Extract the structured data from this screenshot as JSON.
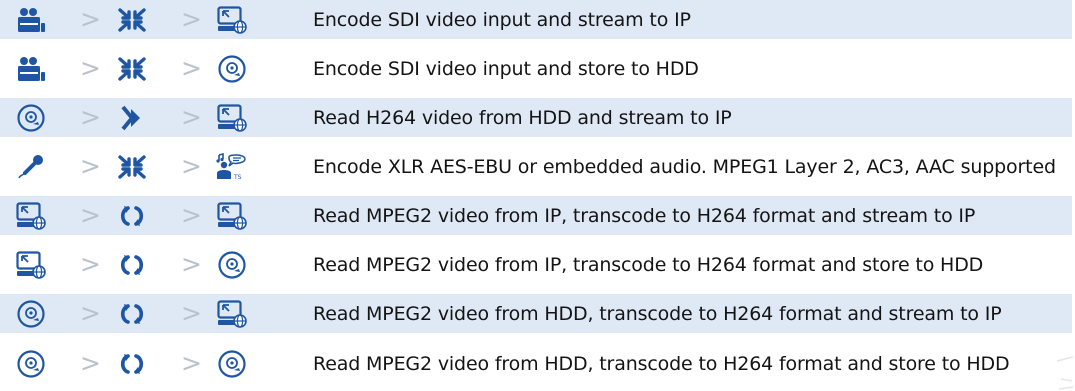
{
  "colors": {
    "icon_blue": "#1f56a4",
    "row_stripe": "#dfe9f5",
    "separator": "#b9c2cc"
  },
  "separator": ">",
  "rows": [
    {
      "icons": [
        "sdi-camera-icon",
        "encode-icon",
        "ip-stream-icon"
      ],
      "text": "Encode SDI video input and stream to IP"
    },
    {
      "icons": [
        "sdi-camera-icon",
        "encode-icon",
        "hdd-icon"
      ],
      "text": "Encode SDI video input and store to HDD"
    },
    {
      "icons": [
        "hdd-icon",
        "play-forward-icon",
        "ip-stream-icon"
      ],
      "text": "Read H264 video from HDD and stream to IP"
    },
    {
      "icons": [
        "microphone-icon",
        "encode-icon",
        "audio-ts-icon"
      ],
      "text": "Encode XLR AES-EBU or embedded audio. MPEG1 Layer 2, AC3, AAC supported"
    },
    {
      "icons": [
        "ip-stream-icon",
        "transcode-icon",
        "ip-stream-icon"
      ],
      "text": "Read MPEG2 video from IP, transcode to H264 format and stream to IP"
    },
    {
      "icons": [
        "ip-stream-icon",
        "transcode-icon",
        "hdd-icon"
      ],
      "text": "Read MPEG2 video from IP, transcode to H264 format and store to HDD"
    },
    {
      "icons": [
        "hdd-icon",
        "transcode-icon",
        "ip-stream-icon"
      ],
      "text": "Read MPEG2 video from HDD, transcode to H264 format and stream to IP"
    },
    {
      "icons": [
        "hdd-icon",
        "transcode-icon",
        "hdd-icon"
      ],
      "text": "Read MPEG2 video from HDD, transcode to H264 format and store to HDD"
    }
  ]
}
